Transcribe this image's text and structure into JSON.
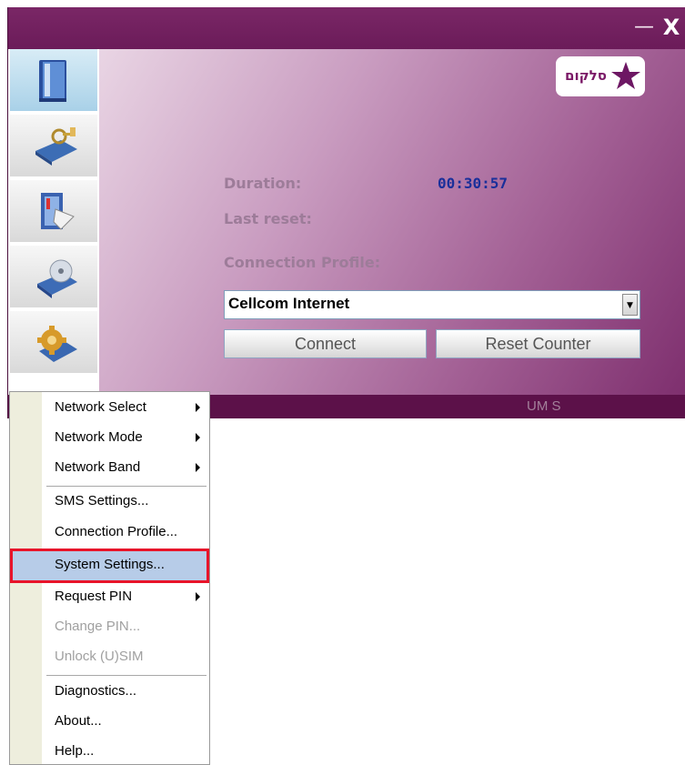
{
  "window": {
    "minimize_label": "—",
    "close_label": "X"
  },
  "toolbar": {
    "items": [
      {
        "icon": "phonebook-icon",
        "active": true
      },
      {
        "icon": "connection-key-icon",
        "active": false
      },
      {
        "icon": "messages-icon",
        "active": false
      },
      {
        "icon": "disc-statistics-icon",
        "active": false
      },
      {
        "icon": "settings-gear-icon",
        "active": false
      }
    ]
  },
  "logo": {
    "text": "סלקום"
  },
  "info": {
    "duration_label": "Duration:",
    "duration_value": "00:30:57",
    "last_reset_label": "Last reset:",
    "profile_label": "Connection Profile:"
  },
  "profile_select": {
    "selected": "Cellcom Internet"
  },
  "buttons": {
    "connect": "Connect",
    "reset": "Reset Counter"
  },
  "statusbar": {
    "text": "UM S"
  },
  "menu": {
    "items": [
      {
        "label": "Network Select",
        "submenu": true,
        "disabled": false
      },
      {
        "label": "Network Mode",
        "submenu": true,
        "disabled": false
      },
      {
        "label": "Network Band",
        "submenu": true,
        "disabled": false
      },
      {
        "label": "SMS Settings...",
        "submenu": false,
        "disabled": false
      },
      {
        "label": "Connection Profile...",
        "submenu": false,
        "disabled": false
      },
      {
        "label": "System Settings...",
        "submenu": false,
        "disabled": false,
        "selected": true
      },
      {
        "label": "Request PIN",
        "submenu": true,
        "disabled": false
      },
      {
        "label": "Change PIN...",
        "submenu": false,
        "disabled": true
      },
      {
        "label": "Unlock (U)SIM",
        "submenu": false,
        "disabled": true
      },
      {
        "label": "Diagnostics...",
        "submenu": false,
        "disabled": false
      },
      {
        "label": "About...",
        "submenu": false,
        "disabled": false
      },
      {
        "label": "Help...",
        "submenu": false,
        "disabled": false
      }
    ]
  },
  "colors": {
    "frame": "#6e1c5a",
    "value_text": "#1a2f9a",
    "label_text": "#9d7c99",
    "menu_highlight": "#b7cce8",
    "highlight_border": "#e8142a"
  }
}
